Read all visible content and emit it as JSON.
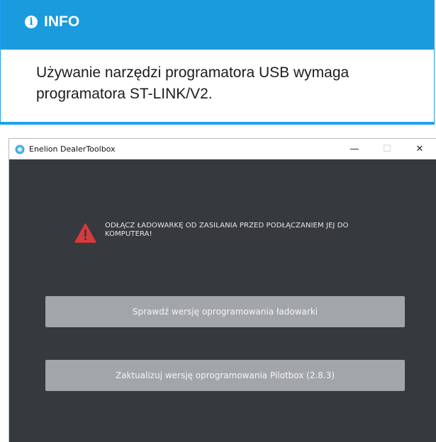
{
  "info": {
    "heading": "INFO",
    "icon": "info-circle-icon",
    "message": "Używanie narzędzi programatora USB wymaga programatora ST-LINK/V2.",
    "accent_color": "#1a9bde"
  },
  "window": {
    "title": "Enelion DealerToolbox",
    "icon": "app-logo-icon",
    "controls": {
      "minimize": "—",
      "maximize": "☐",
      "close": "✕"
    },
    "background_color": "#36393e"
  },
  "warning": {
    "icon": "warning-triangle-icon",
    "color": "#d9393c",
    "text": "ODŁĄCZ ŁADOWARKĘ OD ZASILANIA PRZED PODŁĄCZANIEM JEJ DO KOMPUTERA!"
  },
  "buttons": {
    "check_firmware": "Sprawdź wersję oprogramowania ładowarki",
    "update_pilotbox": "Zaktualizuj wersję oprogramowania Pilotbox (2.8.3)"
  }
}
